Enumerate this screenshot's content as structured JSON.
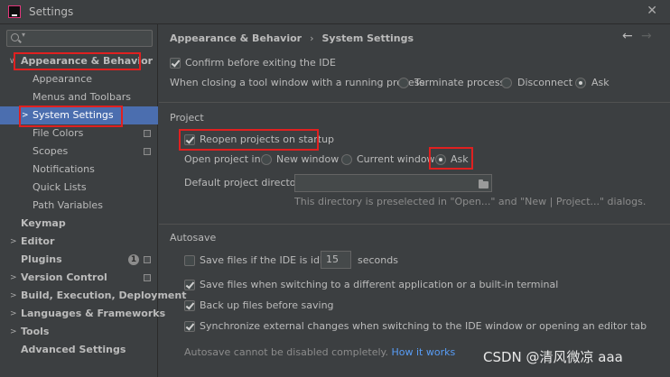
{
  "window": {
    "title": "Settings",
    "close_glyph": "✕"
  },
  "search": {
    "placeholder": "",
    "caret": "▾"
  },
  "sidebar": {
    "items": [
      {
        "label": "Appearance & Behavior",
        "arrow": "∨"
      },
      {
        "label": "Appearance"
      },
      {
        "label": "Menus and Toolbars"
      },
      {
        "label": "System Settings",
        "arrow": ">"
      },
      {
        "label": "File Colors"
      },
      {
        "label": "Scopes"
      },
      {
        "label": "Notifications"
      },
      {
        "label": "Quick Lists"
      },
      {
        "label": "Path Variables"
      },
      {
        "label": "Keymap"
      },
      {
        "label": "Editor",
        "arrow": ">"
      },
      {
        "label": "Plugins",
        "badge": "1"
      },
      {
        "label": "Version Control",
        "arrow": ">"
      },
      {
        "label": "Build, Execution, Deployment",
        "arrow": ">"
      },
      {
        "label": "Languages & Frameworks",
        "arrow": ">"
      },
      {
        "label": "Tools",
        "arrow": ">"
      },
      {
        "label": "Advanced Settings"
      }
    ]
  },
  "header": {
    "breadcrumb_parent": "Appearance & Behavior",
    "breadcrumb_sep": "›",
    "breadcrumb_current": "System Settings",
    "back_glyph": "←",
    "forward_glyph": "→"
  },
  "general": {
    "confirm_exit": "Confirm before exiting the IDE",
    "closing_label": "When closing a tool window with a running process:",
    "options": [
      "Terminate process",
      "Disconnect",
      "Ask"
    ],
    "selected": "Ask"
  },
  "project": {
    "section": "Project",
    "reopen": "Reopen projects on startup",
    "open_in_label": "Open project in",
    "open_options": [
      "New window",
      "Current window",
      "Ask"
    ],
    "selected": "Ask",
    "dir_label": "Default project directory:",
    "dir_value": "",
    "dir_hint": "This directory is preselected in \"Open...\" and \"New | Project...\" dialogs."
  },
  "autosave": {
    "section": "Autosave",
    "idle_prefix": "Save files if the IDE is idle for",
    "idle_seconds": "15",
    "idle_suffix": "seconds",
    "switching": "Save files when switching to a different application or a built-in terminal",
    "backup": "Back up files before saving",
    "sync": "Synchronize external changes when switching to the IDE window or opening an editor tab",
    "note": "Autosave cannot be disabled completely.",
    "note_link": "How it works"
  },
  "watermark": "CSDN @清风微凉 aaa",
  "colors": {
    "selection": "#4b6eaf",
    "highlight": "#e02020",
    "link": "#589df6",
    "background": "#3c3f41"
  }
}
